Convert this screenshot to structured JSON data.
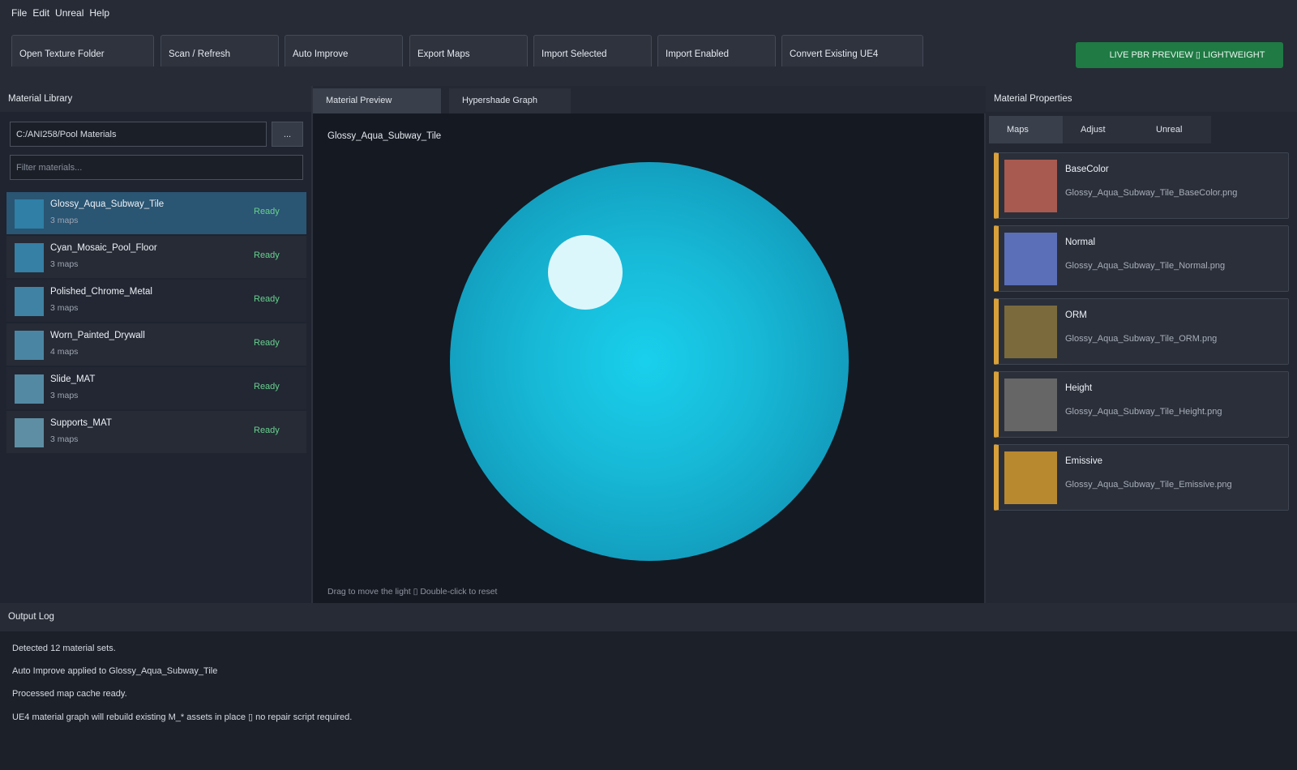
{
  "menu": [
    "File",
    "Edit",
    "Unreal",
    "Help"
  ],
  "toolbar": {
    "buttons": [
      "Open Texture Folder",
      "Scan / Refresh",
      "Auto Improve",
      "Export Maps",
      "Import Selected",
      "Import Enabled",
      "Convert Existing UE4"
    ],
    "live_label": "LIVE PBR PREVIEW ▯ LIGHTWEIGHT",
    "live_color": "#1f7a44"
  },
  "library": {
    "title": "Material Library",
    "path_value": "C:/ANI258/Pool Materials",
    "browse_label": "...",
    "filter_placeholder": "Filter materials...",
    "materials": [
      {
        "name": "Glossy_Aqua_Subway_Tile",
        "maps": "3 maps",
        "status": "Ready",
        "color": "#2f7fa6"
      },
      {
        "name": "Cyan_Mosaic_Pool_Floor",
        "maps": "3 maps",
        "status": "Ready",
        "color": "#367fa5"
      },
      {
        "name": "Polished_Chrome_Metal",
        "maps": "3 maps",
        "status": "Ready",
        "color": "#3f82a3"
      },
      {
        "name": "Worn_Painted_Drywall",
        "maps": "4 maps",
        "status": "Ready",
        "color": "#4a86a3"
      },
      {
        "name": "Slide_MAT",
        "maps": "3 maps",
        "status": "Ready",
        "color": "#5489a3"
      },
      {
        "name": "Supports_MAT",
        "maps": "3 maps",
        "status": "Ready",
        "color": "#5e8ea3"
      }
    ]
  },
  "preview": {
    "tabs": [
      "Material Preview",
      "Hypershade Graph"
    ],
    "material_name": "Glossy_Aqua_Subway_Tile",
    "hint": "Drag to move the light ▯ Double-click to reset"
  },
  "properties": {
    "title": "Material Properties",
    "tabs": [
      "Maps",
      "Adjust",
      "Unreal"
    ],
    "maps": [
      {
        "label": "BaseColor",
        "file": "Glossy_Aqua_Subway_Tile_BaseColor.png",
        "color": "#a85a50"
      },
      {
        "label": "Normal",
        "file": "Glossy_Aqua_Subway_Tile_Normal.png",
        "color": "#5a6fb8"
      },
      {
        "label": "ORM",
        "file": "Glossy_Aqua_Subway_Tile_ORM.png",
        "color": "#7b6a3c"
      },
      {
        "label": "Height",
        "file": "Glossy_Aqua_Subway_Tile_Height.png",
        "color": "#666666"
      },
      {
        "label": "Emissive",
        "file": "Glossy_Aqua_Subway_Tile_Emissive.png",
        "color": "#b98930"
      }
    ]
  },
  "output_log": {
    "title": "Output Log",
    "lines": [
      "Detected 12 material sets.",
      "Auto Improve applied to Glossy_Aqua_Subway_Tile",
      "Processed map cache ready.",
      "UE4 material graph will rebuild existing M_* assets in place ▯ no repair script required."
    ]
  }
}
